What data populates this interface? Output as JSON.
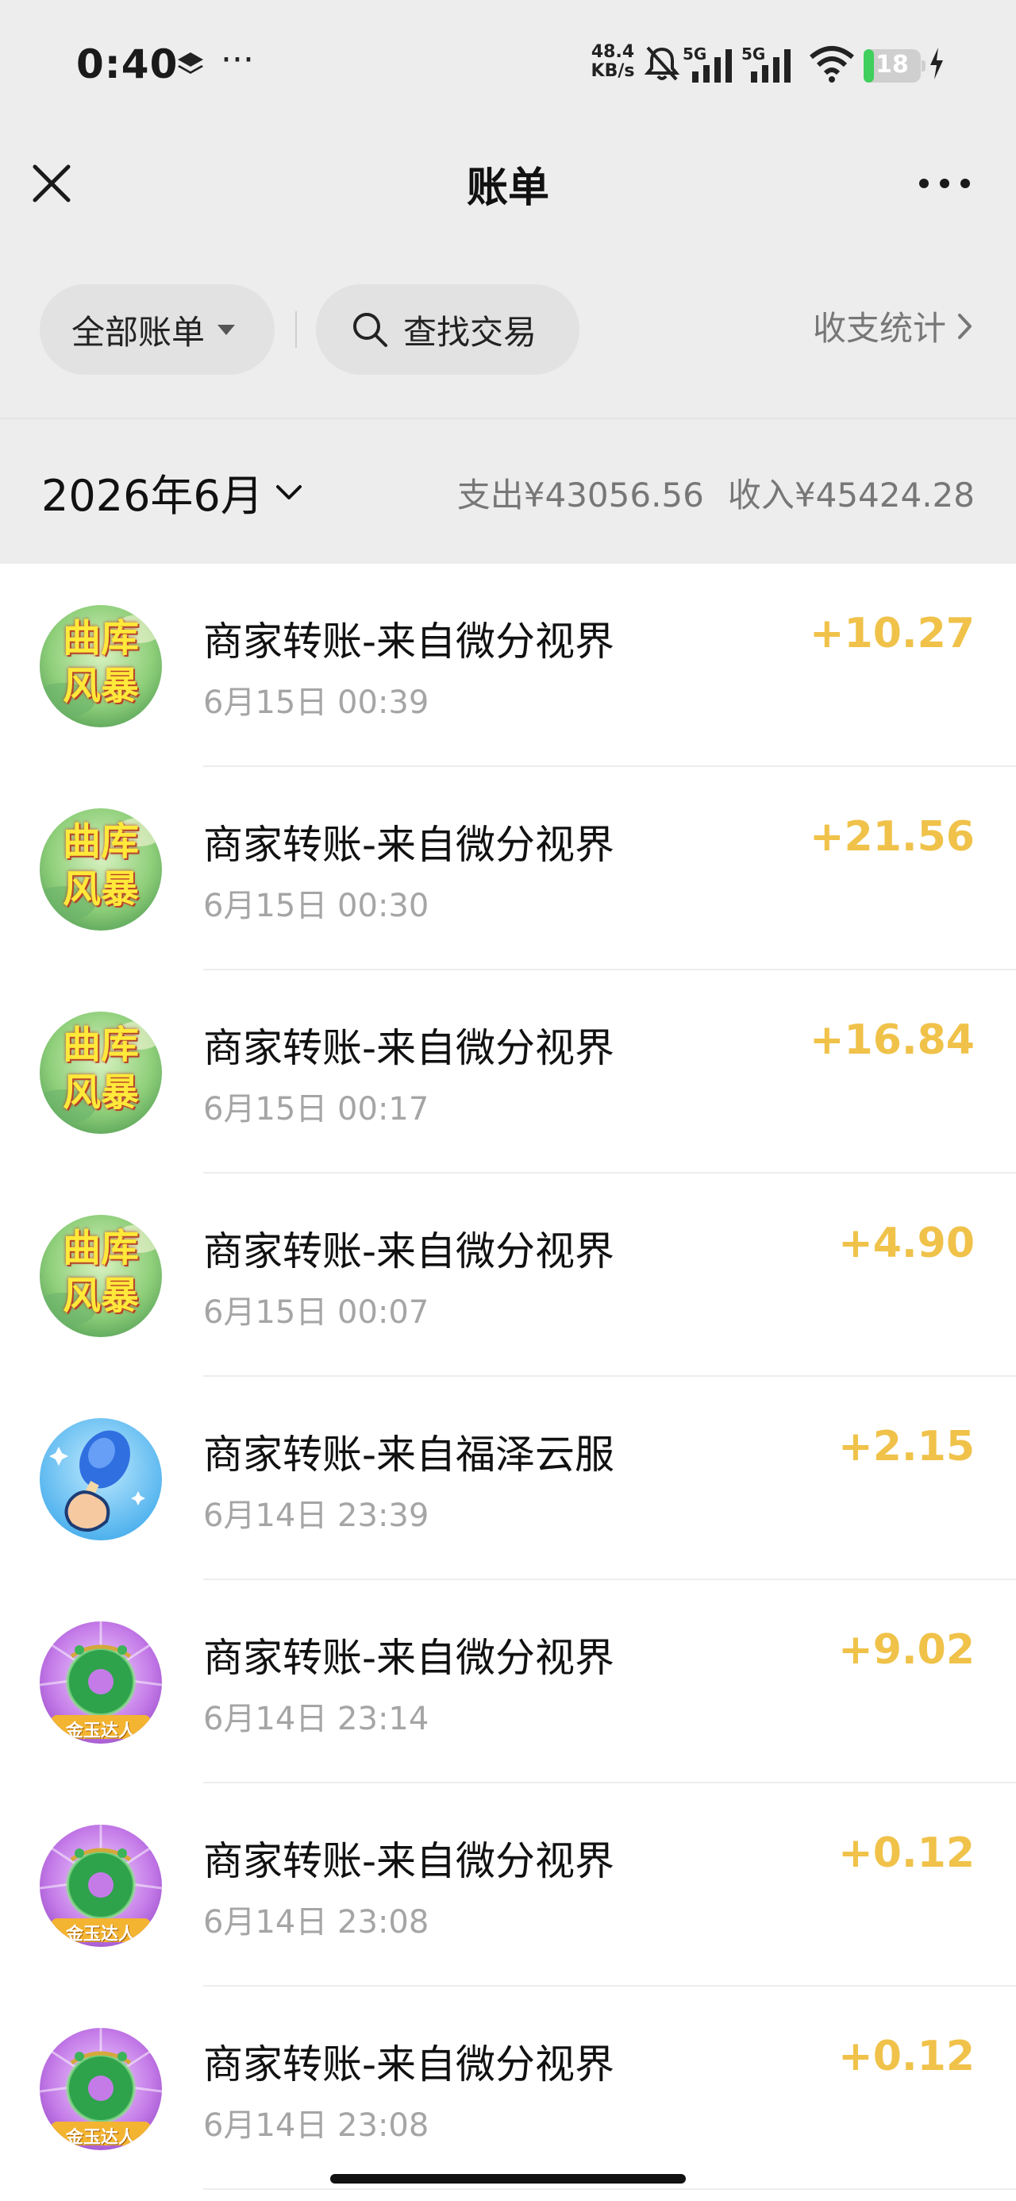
{
  "status_bar": {
    "time": "0:40",
    "dots": "···",
    "net_speed_value": "48.4",
    "net_speed_unit": "KB/s",
    "sim1_label": "5G",
    "sim2_label": "5G",
    "battery_level": "18",
    "battery_fraction": 0.18
  },
  "header": {
    "title": "账单",
    "close_icon": "close-icon",
    "more_icon": "more-icon"
  },
  "filters": {
    "all_bills_label": "全部账单",
    "search_label": "查找交易",
    "stats_label": "收支统计"
  },
  "month": {
    "label": "2026年6月",
    "expense": "支出¥43056.56",
    "income": "收入¥45424.28"
  },
  "colors": {
    "page_bg": "#ededed",
    "amount": "#f0c24a"
  },
  "transactions": [
    {
      "title": "商家转账-来自微分视界",
      "time": "6月15日 00:39",
      "amount": "+10.27",
      "avatar": "storm-avatar",
      "avatar_text_1": "曲库",
      "avatar_text_2": "风暴"
    },
    {
      "title": "商家转账-来自微分视界",
      "time": "6月15日 00:30",
      "amount": "+21.56",
      "avatar": "storm-avatar",
      "avatar_text_1": "曲库",
      "avatar_text_2": "风暴"
    },
    {
      "title": "商家转账-来自微分视界",
      "time": "6月15日 00:17",
      "amount": "+16.84",
      "avatar": "storm-avatar",
      "avatar_text_1": "曲库",
      "avatar_text_2": "风暴"
    },
    {
      "title": "商家转账-来自微分视界",
      "time": "6月15日 00:07",
      "amount": "+4.90",
      "avatar": "storm-avatar",
      "avatar_text_1": "曲库",
      "avatar_text_2": "风暴"
    },
    {
      "title": "商家转账-来自福泽云服",
      "time": "6月14日 23:39",
      "amount": "+2.15",
      "avatar": "popsicle-avatar"
    },
    {
      "title": "商家转账-来自微分视界",
      "time": "6月14日 23:14",
      "amount": "+9.02",
      "avatar": "jade-avatar",
      "avatar_text_1": "金玉达人"
    },
    {
      "title": "商家转账-来自微分视界",
      "time": "6月14日 23:08",
      "amount": "+0.12",
      "avatar": "jade-avatar",
      "avatar_text_1": "金玉达人"
    },
    {
      "title": "商家转账-来自微分视界",
      "time": "6月14日 23:08",
      "amount": "+0.12",
      "avatar": "jade-avatar",
      "avatar_text_1": "金玉达人"
    }
  ]
}
